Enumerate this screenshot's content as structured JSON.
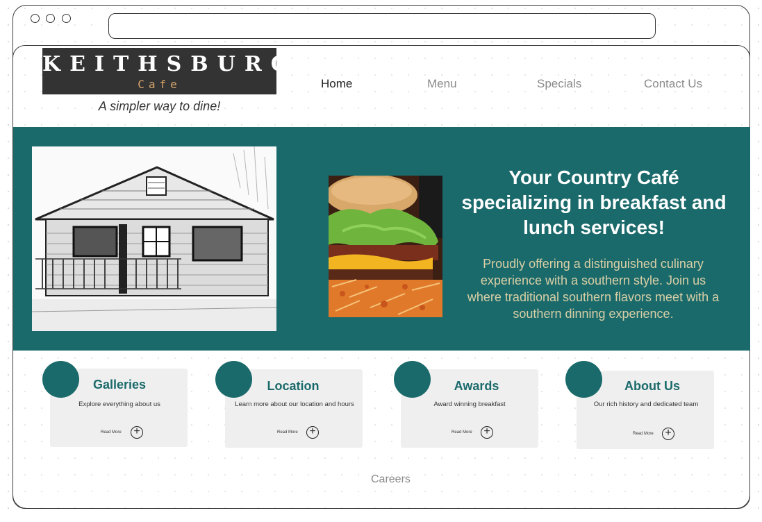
{
  "header": {
    "logo_name": "KEITHSBURG",
    "logo_sub": "Cafe",
    "tagline": "A simpler way to dine!"
  },
  "nav": [
    "Home",
    "Menu",
    "Specials",
    "Contact Us"
  ],
  "hero": {
    "title": "Your Country Café specializing in breakfast and lunch services!",
    "text": "Proudly offering a distinguished culinary experience with a southern style.  Join us where traditional southern flavors meet with a southern dinning experience."
  },
  "cards": [
    {
      "title": "Galleries",
      "desc": "Explore everything about us",
      "read": "Read More"
    },
    {
      "title": "Location",
      "desc": "Learn more about our location and hours",
      "read": "Read More"
    },
    {
      "title": "Awards",
      "desc": "Award winning breakfast",
      "read": "Read More"
    },
    {
      "title": "About Us",
      "desc": "Our rich history and dedicated team",
      "read": "Read More"
    }
  ],
  "footer": {
    "careers": "Careers"
  },
  "colors": {
    "accent": "#1b6a6b",
    "hero_text": "#d8cfa6",
    "logo_bg": "#333333"
  }
}
